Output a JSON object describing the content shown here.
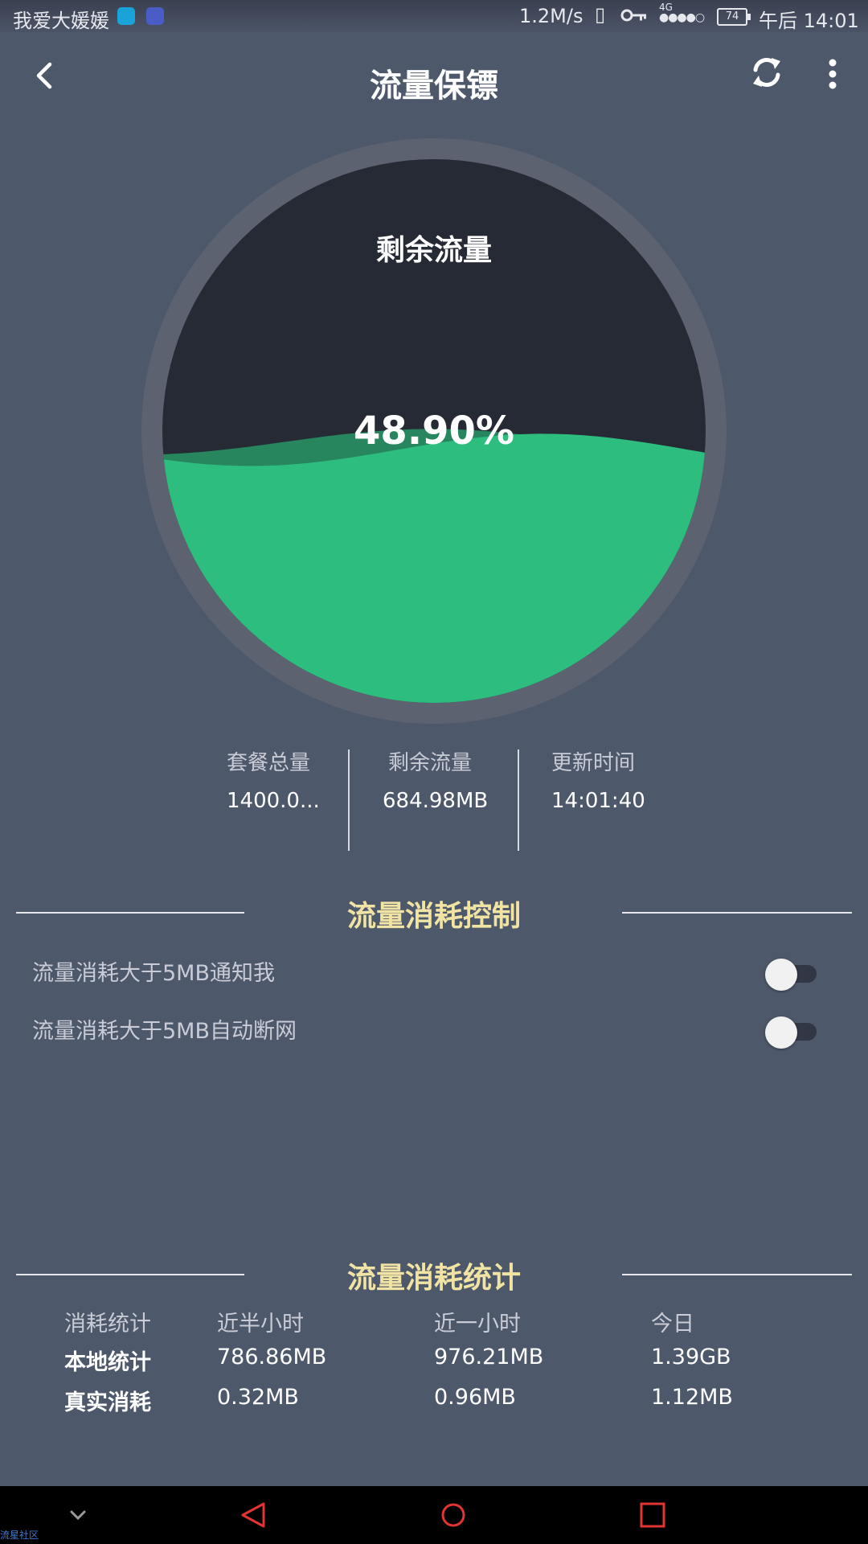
{
  "status_bar": {
    "carrier": "我爱大媛媛",
    "speed": "1.2M/s",
    "network_type": "4G",
    "battery": "74",
    "time": "午后 14:01"
  },
  "toolbar": {
    "title": "流量保镖"
  },
  "gauge": {
    "label": "剩余流量",
    "percent_text": "48.90%",
    "fill_fraction": 0.489,
    "colors": {
      "ring": "#5d6270",
      "empty": "#262a35",
      "fill": "#2dbd7e",
      "back_wave": "#28865f"
    }
  },
  "summary": {
    "total_label": "套餐总量",
    "total_value": "1400.0...",
    "remaining_label": "剩余流量",
    "remaining_value": "684.98MB",
    "update_label": "更新时间",
    "update_value": "14:01:40"
  },
  "control": {
    "title": "流量消耗控制",
    "notify_label": "流量消耗大于5MB通知我",
    "notify_on": false,
    "disconnect_label": "流量消耗大于5MB自动断网",
    "disconnect_on": false
  },
  "stats": {
    "title": "流量消耗统计",
    "headers": [
      "消耗统计",
      "近半小时",
      "近一小时",
      "今日"
    ],
    "local": {
      "label": "本地统计",
      "half_hour": "786.86MB",
      "one_hour": "976.21MB",
      "today": "1.39GB"
    },
    "real": {
      "label": "真实消耗",
      "half_hour": "0.32MB",
      "one_hour": "0.96MB",
      "today": "1.12MB"
    }
  },
  "watermark": "流星社区",
  "theme": {
    "background": "#4e586b",
    "accent_title": "#f1e3a4"
  }
}
